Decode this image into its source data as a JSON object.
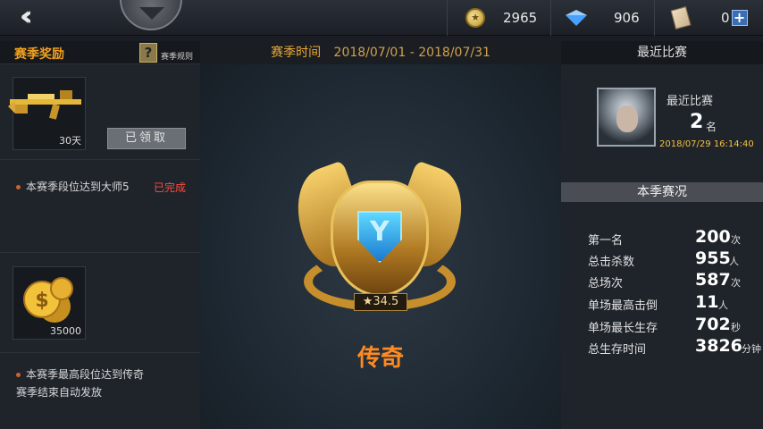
{
  "resources": {
    "coins": "2965",
    "diamonds": "906",
    "tickets": "0"
  },
  "left_panel": {
    "title": "赛季奖励",
    "rules_label": "赛季规则",
    "rules_icon": "?",
    "reward1": {
      "qty": "30天",
      "icon": "golden-sniper-rifle-icon"
    },
    "claim_button": "已领取",
    "task1": "本赛季段位达到大师5",
    "task1_status": "已完成",
    "reward2": {
      "qty": "35000",
      "icon": "gold-coins-icon"
    },
    "task2_line1": "本赛季最高段位达到传奇",
    "task2_line2": "赛季结束自动发放"
  },
  "center": {
    "season_label": "赛季时间",
    "season_range": "2018/07/01 - 2018/07/31",
    "score": "★34.5",
    "rank_name": "传奇",
    "badge_icon": "legend-rank-badge-icon"
  },
  "right_panel": {
    "title": "最近比赛",
    "recent_label": "最近比赛",
    "recent_rank": "2",
    "recent_unit": "名",
    "recent_time": "2018/07/29 16:14:40",
    "season_title": "本季赛况",
    "stats": [
      {
        "label": "第一名",
        "value": "200",
        "unit": "次"
      },
      {
        "label": "总击杀数",
        "value": "955",
        "unit": "人"
      },
      {
        "label": "总场次",
        "value": "587",
        "unit": "次"
      },
      {
        "label": "单场最高击倒",
        "value": "11",
        "unit": "人"
      },
      {
        "label": "单场最长生存",
        "value": "702",
        "unit": "秒"
      },
      {
        "label": "总生存时间",
        "value": "3826",
        "unit": "分钟"
      }
    ]
  },
  "colors": {
    "accent_orange": "#f0a020",
    "rank_orange": "#ff8a20",
    "done_red": "#ff4a3a",
    "time_yellow": "#f5c040"
  }
}
